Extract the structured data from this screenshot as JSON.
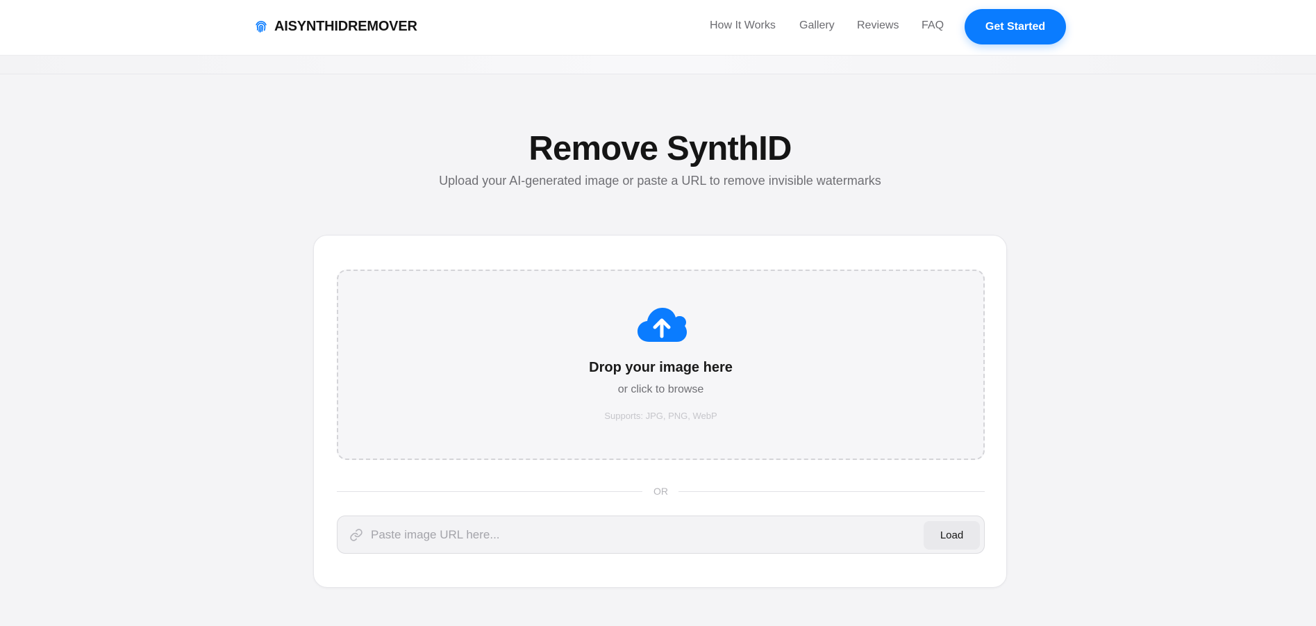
{
  "header": {
    "brand": "AISYNTHIDREMOVER",
    "brand_icon": "fingerprint-icon",
    "nav": [
      {
        "label": "How It Works"
      },
      {
        "label": "Gallery"
      },
      {
        "label": "Reviews"
      },
      {
        "label": "FAQ"
      }
    ],
    "cta_label": "Get Started"
  },
  "hero": {
    "title": "Remove SynthID",
    "subtitle": "Upload your AI-generated image or paste a URL to remove invisible watermarks"
  },
  "upload": {
    "icon": "cloud-upload-icon",
    "title": "Drop your image here",
    "subtitle": "or click to browse",
    "supports": "Supports: JPG, PNG, WebP"
  },
  "divider": {
    "text": "OR"
  },
  "url": {
    "icon": "link-icon",
    "placeholder": "Paste image URL here...",
    "value": "",
    "load_label": "Load"
  },
  "colors": {
    "accent": "#0a7cff",
    "background": "#f4f4f6",
    "card": "#ffffff"
  }
}
